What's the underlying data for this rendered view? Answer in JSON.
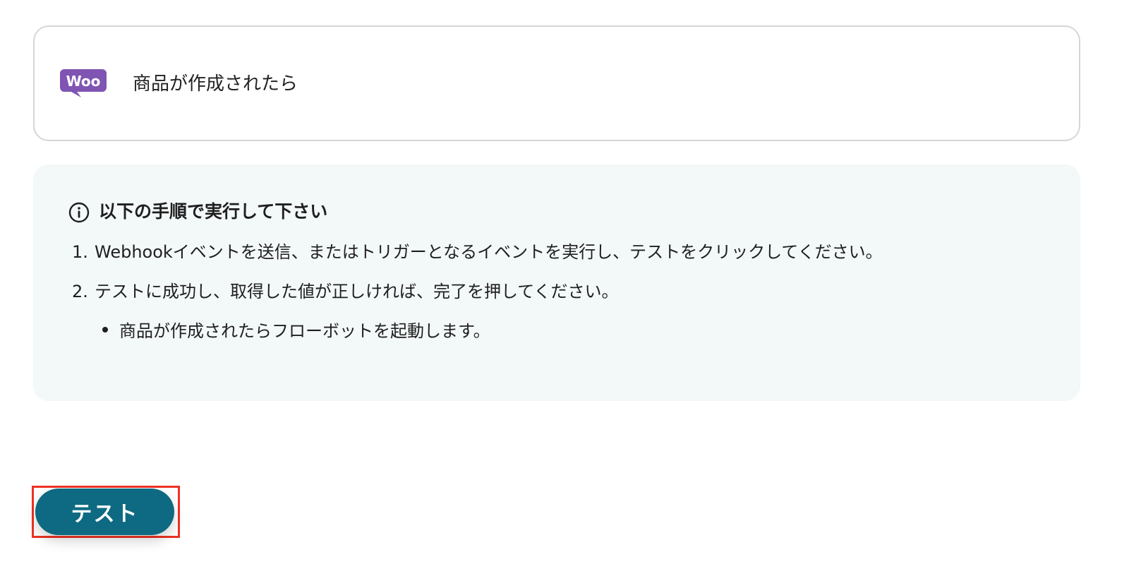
{
  "trigger": {
    "logo_text": "Woo",
    "label": "商品が作成されたら"
  },
  "instructions": {
    "title": "以下の手順で実行して下さい",
    "steps": [
      {
        "num": "1.",
        "text": "Webhookイベントを送信、またはトリガーとなるイベントを実行し、テストをクリックしてください。"
      },
      {
        "num": "2.",
        "text": "テストに成功し、取得した値が正しければ、完了を押してください。"
      }
    ],
    "sub_bullet": "商品が作成されたらフローボットを起動します。"
  },
  "test_button": {
    "label": "テスト"
  },
  "colors": {
    "woo_purple": "#7f54b3",
    "panel_bg": "#f3f8f8",
    "button_bg": "#0e6a82",
    "highlight": "#ee3324"
  }
}
